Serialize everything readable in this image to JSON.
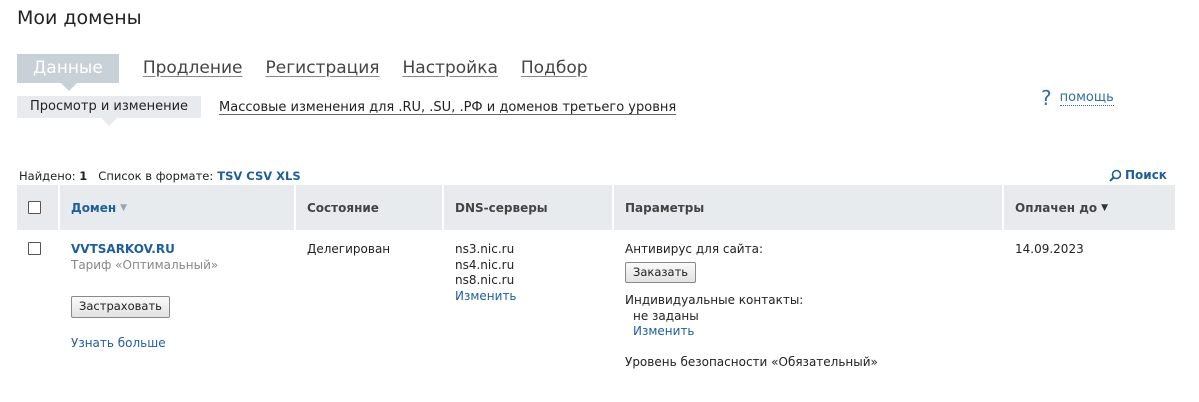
{
  "page": {
    "title": "Мои домены"
  },
  "main_tabs": [
    {
      "label": "Данные",
      "active": true
    },
    {
      "label": "Продление"
    },
    {
      "label": "Регистрация"
    },
    {
      "label": "Настройка"
    },
    {
      "label": "Подбор"
    }
  ],
  "sub_tabs": [
    {
      "label": "Просмотр и изменение",
      "active": true
    },
    {
      "label": "Массовые изменения для .RU, .SU, .РФ и доменов третьего уровня"
    }
  ],
  "help": {
    "icon": "?",
    "label": "помощь"
  },
  "list_bar": {
    "found_label": "Найдено:",
    "found_count": "1",
    "format_label": "Список в формате:",
    "formats": [
      "TSV",
      "CSV",
      "XLS"
    ],
    "search_label": "Поиск"
  },
  "table": {
    "headers": {
      "domain": "Домен",
      "state": "Состояние",
      "dns": "DNS-серверы",
      "params": "Параметры",
      "paid_until": "Оплачен до"
    },
    "rows": [
      {
        "domain": "VVTSARKOV.RU",
        "tariff": "Тариф «Оптимальный»",
        "insure_button": "Застраховать",
        "learn_more": "Узнать больше",
        "state": "Делегирован",
        "dns": [
          "ns3.nic.ru",
          "ns4.nic.ru",
          "ns8.nic.ru"
        ],
        "dns_change": "Изменить",
        "antivirus_label": "Антивирус для сайта:",
        "order_button": "Заказать",
        "contacts_label": "Индивидуальные контакты:",
        "contacts_value": "не заданы",
        "contacts_change": "Изменить",
        "security_level": "Уровень безопасности «Обязательный»",
        "paid_until": "14.09.2023"
      }
    ]
  },
  "colors": {
    "link": "#1d5f9c",
    "active_tab_bg": "#c9d1d8",
    "header_bg": "#e8ebee"
  }
}
